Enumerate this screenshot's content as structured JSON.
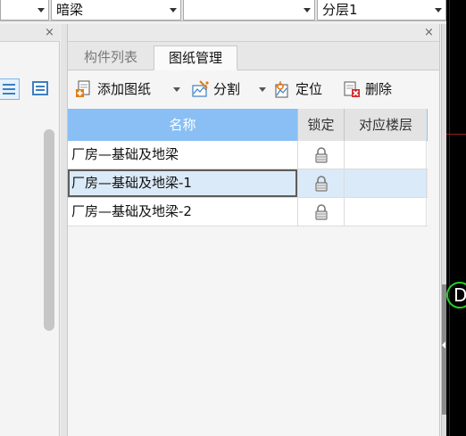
{
  "topbar": {
    "combo1": {
      "value": ""
    },
    "combo2": {
      "value": "暗梁"
    },
    "combo3": {
      "value": ""
    },
    "combo4": {
      "value": "分层1"
    }
  },
  "left_panel": {
    "close_label": "×"
  },
  "panel": {
    "close_label": "×",
    "tabs": [
      {
        "label": "构件列表",
        "active": false
      },
      {
        "label": "图纸管理",
        "active": true
      }
    ],
    "toolbar": {
      "add_drawing": "添加图纸",
      "split": "分割",
      "locate": "定位",
      "delete": "删除"
    }
  },
  "grid": {
    "columns": [
      "名称",
      "锁定",
      "对应楼层"
    ],
    "rows": [
      {
        "name": "厂房—基础及地梁",
        "locked": true,
        "floor": "",
        "selected": false
      },
      {
        "name": "厂房—基础及地梁-1",
        "locked": true,
        "floor": "",
        "selected": true
      },
      {
        "name": "厂房—基础及地梁-2",
        "locked": true,
        "floor": "",
        "selected": false
      }
    ]
  },
  "canvas": {
    "label": "D",
    "colors": {
      "circle": "#27d027",
      "axis": "#9a1f1f",
      "background": "#000000"
    }
  },
  "colors": {
    "header_blue": "#89bff4",
    "selected_row": "#dbeaf8"
  }
}
